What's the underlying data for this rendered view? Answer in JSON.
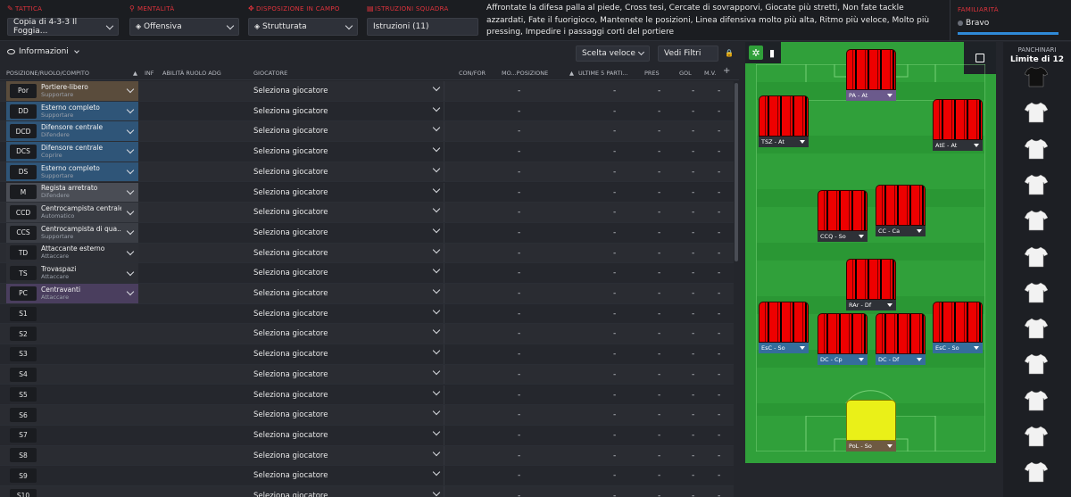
{
  "tactic": {
    "label": "TATTICA",
    "value": "Copia di 4-3-3 Il Foggia..."
  },
  "mentality": {
    "label": "MENTALITÀ",
    "value": "Offensiva"
  },
  "formation": {
    "label": "DISPOSIZIONE IN CAMPO",
    "value": "Strutturata"
  },
  "team_instructions": {
    "label": "ISTRUZIONI SQUADRA",
    "value": "Istruzioni (11)"
  },
  "instructions_text": "Affrontate la difesa palla al piede, Cross tesi, Cercate di sovrapporvi, Giocate più stretti, Non fate tackle azzardati, Fate il fuorigioco, Mantenete le posizioni, Linea difensiva molto più alta, Ritmo più veloce, Molto più pressing, Impedire i passaggi corti del portiere",
  "familiarity": {
    "label": "FAMILIARITÀ",
    "value": "Bravo"
  },
  "toolbar": {
    "info_label": "Informazioni",
    "quick_pick": "Scelta veloce",
    "view_filters": "Vedi Filtri"
  },
  "columns": {
    "role": "POSIZIONE/RUOLO/COMPITO",
    "inf": "INF",
    "role_ability": "ABILITÀ RUOLO ADG",
    "player": "GIOCATORE",
    "con_for": "CON/FOR",
    "mo_pos": "MO...POSIZIONE",
    "last5": "ULTIME 5 PARTI...",
    "pres": "PRES",
    "gol": "GOL",
    "mv": "M.V."
  },
  "select_player_text": "Seleziona giocatore",
  "dash": "-",
  "rows": [
    {
      "pos": "Por",
      "name": "Portiere-libero",
      "duty": "Supportare",
      "color": "#5a4c3c"
    },
    {
      "pos": "DD",
      "name": "Esterno completo",
      "duty": "Supportare",
      "color": "#2f5578"
    },
    {
      "pos": "DCD",
      "name": "Difensore centrale",
      "duty": "Difendere",
      "color": "#2f5578"
    },
    {
      "pos": "DCS",
      "name": "Difensore centrale",
      "duty": "Coprire",
      "color": "#2f5578"
    },
    {
      "pos": "DS",
      "name": "Esterno completo",
      "duty": "Supportare",
      "color": "#2f5578"
    },
    {
      "pos": "M",
      "name": "Regista arretrato",
      "duty": "Difendere",
      "color": "#4a4d55"
    },
    {
      "pos": "CCD",
      "name": "Centrocampista centrale",
      "duty": "Automatico",
      "color": "#3a3d44"
    },
    {
      "pos": "CCS",
      "name": "Centrocampista di qua...",
      "duty": "Supportare",
      "color": "#3a3d44"
    },
    {
      "pos": "TD",
      "name": "Attaccante esterno",
      "duty": "Attaccare",
      "color": "#2c2e34"
    },
    {
      "pos": "TS",
      "name": "Trovaspazi",
      "duty": "Attaccare",
      "color": "#2c2e34"
    },
    {
      "pos": "PC",
      "name": "Centravanti",
      "duty": "Attaccare",
      "color": "#4a3e5e"
    },
    {
      "pos": "S1",
      "name": "",
      "duty": "",
      "color": ""
    },
    {
      "pos": "S2",
      "name": "",
      "duty": "",
      "color": ""
    },
    {
      "pos": "S3",
      "name": "",
      "duty": "",
      "color": ""
    },
    {
      "pos": "S4",
      "name": "",
      "duty": "",
      "color": ""
    },
    {
      "pos": "S5",
      "name": "",
      "duty": "",
      "color": ""
    },
    {
      "pos": "S6",
      "name": "",
      "duty": "",
      "color": ""
    },
    {
      "pos": "S7",
      "name": "",
      "duty": "",
      "color": ""
    },
    {
      "pos": "S8",
      "name": "",
      "duty": "",
      "color": ""
    },
    {
      "pos": "S9",
      "name": "",
      "duty": "",
      "color": ""
    },
    {
      "pos": "S10",
      "name": "",
      "duty": "",
      "color": ""
    }
  ],
  "pitch_players": [
    {
      "label": "PA - At",
      "style": "purple",
      "gk": false
    },
    {
      "label": "TSZ - At",
      "style": "dark",
      "gk": false
    },
    {
      "label": "AtE - At",
      "style": "dark",
      "gk": false
    },
    {
      "label": "CCQ - So",
      "style": "dark",
      "gk": false
    },
    {
      "label": "CC - Ca",
      "style": "dark",
      "gk": false
    },
    {
      "label": "RAr - Df",
      "style": "dark",
      "gk": false
    },
    {
      "label": "EsC - So",
      "style": "blue",
      "gk": false
    },
    {
      "label": "DC - Cp",
      "style": "blue",
      "gk": false
    },
    {
      "label": "DC - Df",
      "style": "blue",
      "gk": false
    },
    {
      "label": "EsC - So",
      "style": "blue",
      "gk": false
    },
    {
      "label": "PoL - So",
      "style": "brown",
      "gk": true
    }
  ],
  "bench": {
    "title": "PANCHINARI",
    "limit": "Limite di 12",
    "count": 12
  }
}
